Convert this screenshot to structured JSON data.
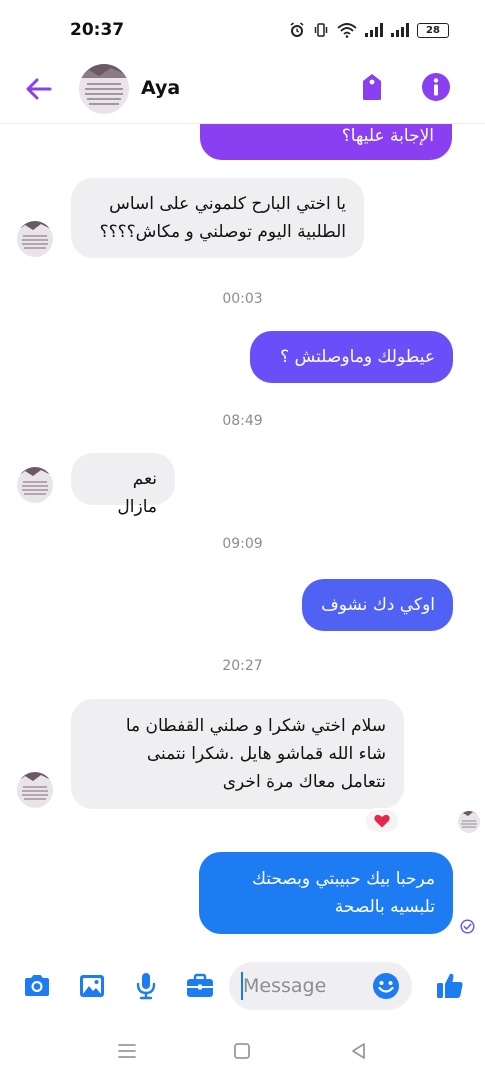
{
  "status_bar": {
    "time": "20:37",
    "battery": "28",
    "icons": [
      "alarm-icon",
      "vibrate-icon",
      "wifi-icon",
      "signal-icon",
      "signal-icon",
      "battery-icon"
    ]
  },
  "header": {
    "contact_name": "Aya",
    "icons": [
      "back-arrow-icon",
      "tag-icon",
      "info-icon"
    ],
    "accent": "#8a3ff1"
  },
  "messages": [
    {
      "direction": "outgoing",
      "text": "الإجابة عليها؟"
    },
    {
      "direction": "incoming",
      "lines": [
        "يا اختي البارح كلموني على اساس",
        "الطلبية اليوم توصلني و مكاش؟؟؟؟"
      ]
    },
    {
      "type": "timestamp",
      "text": "00:03"
    },
    {
      "direction": "outgoing",
      "text": "عيطولك وماوصلتش ؟"
    },
    {
      "type": "timestamp",
      "text": "08:49"
    },
    {
      "direction": "incoming",
      "text": "نعم مازال"
    },
    {
      "type": "timestamp",
      "text": "09:09"
    },
    {
      "direction": "outgoing",
      "text": "اوكي دك نشوف"
    },
    {
      "type": "timestamp",
      "text": "20:27"
    },
    {
      "direction": "incoming",
      "lines": [
        "سلام اختي شكرا و صلني القفطان ما",
        "شاء الله قماشو هايل .شكرا نتمنى",
        "نتعامل معاك مرة اخرى"
      ],
      "reaction": "heart"
    },
    {
      "direction": "outgoing",
      "lines": [
        "مرحبا بيك حبيبتي  وبصحتك",
        "تلبسيه بالصحة"
      ],
      "status": "sent"
    }
  ],
  "composer": {
    "placeholder": "Message",
    "icons": [
      "camera-icon",
      "gallery-icon",
      "microphone-icon",
      "briefcase-icon",
      "emoji-icon",
      "thumbs-up-icon"
    ],
    "accent": "#1e7cf2"
  },
  "nav_bar": {
    "icons": [
      "menu-icon",
      "home-icon",
      "back-icon"
    ]
  }
}
